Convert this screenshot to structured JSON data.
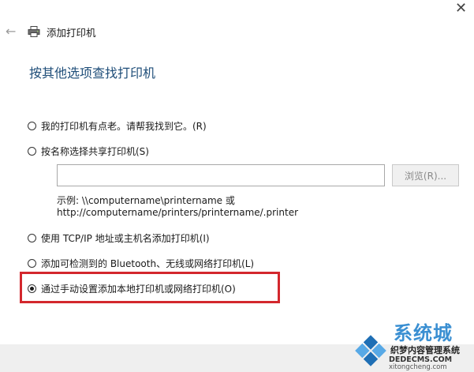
{
  "window": {
    "close_glyph": "✕",
    "back_glyph": "←",
    "title": "添加打印机",
    "title_icon": "printer-icon"
  },
  "heading": "按其他选项查找打印机",
  "options": [
    {
      "label": "我的打印机有点老。请帮我找到它。(R)",
      "checked": false
    },
    {
      "label": "按名称选择共享打印机(S)",
      "checked": false
    },
    {
      "label": "使用 TCP/IP 地址或主机名添加打印机(I)",
      "checked": false
    },
    {
      "label": "添加可检测到的 Bluetooth、无线或网络打印机(L)",
      "checked": false
    },
    {
      "label": "通过手动设置添加本地打印机或网络打印机(O)",
      "checked": true
    }
  ],
  "share_input": {
    "value": "",
    "placeholder": ""
  },
  "browse_label": "浏览(R)...",
  "example_lines": [
    "示例: \\\\computername\\printername 或",
    "http://computername/printers/printername/.printer"
  ],
  "colors": {
    "heading": "#1f4e79",
    "highlight": "#d3272d",
    "watermark_brand": "#3a8fd2"
  },
  "watermark": {
    "brand": "系统城",
    "sub": "织梦内容管理系统",
    "url1": "DEDECMS.COM",
    "url2": "xitongcheng.com"
  }
}
